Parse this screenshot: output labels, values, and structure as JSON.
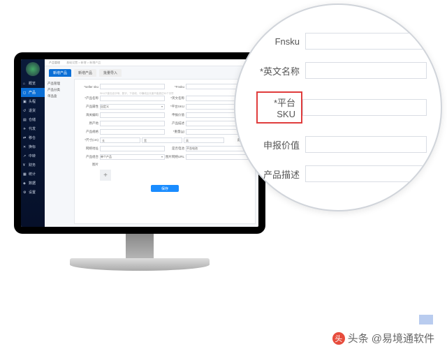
{
  "topbar": {
    "title": "产品管理",
    "crumb": "基础设置 > 新增 > 新增产品"
  },
  "sidebar": {
    "items": [
      {
        "label": "概览"
      },
      {
        "label": "产品"
      },
      {
        "label": "头程"
      },
      {
        "label": "退货"
      },
      {
        "label": "仓储"
      },
      {
        "label": "代发"
      },
      {
        "label": "移仓"
      },
      {
        "label": "换标"
      },
      {
        "label": "中转"
      },
      {
        "label": "财务"
      },
      {
        "label": "统计"
      },
      {
        "label": "数据"
      },
      {
        "label": "设置"
      }
    ]
  },
  "tree": {
    "items": [
      "产品管理",
      "产品分类",
      "单品盒"
    ]
  },
  "tabs": [
    {
      "label": "新增产品",
      "active": true
    },
    {
      "label": "新增产品",
      "active": false
    },
    {
      "label": "批量导入",
      "active": false
    }
  ],
  "form": {
    "seller_sku": "*seller sku",
    "fnsku": "*Fnsku",
    "hint": "SKU只能包含字母、数字、下划线、中横线且长度不能超过30个字符",
    "cn_name": "*产品名称",
    "en_name": "*英文名称",
    "attr": "产品属性",
    "attr_val": "自定义",
    "plat_sku": "*平台SKU",
    "hscode": "海关编码",
    "declare_val": "申报价值",
    "origin": "原产地",
    "desc": "产品描述",
    "spec": "产品规格",
    "weight": "*重量(g)",
    "size": "*尺寸(cm)",
    "size_l": "长",
    "size_w": "宽",
    "size_h": "高",
    "color": "颜色",
    "url": "网络地址",
    "is_battery": "是否电池",
    "is_battery_val": "不含电池",
    "combo": "产品组合",
    "combo_val": "单个产品",
    "img_url": "图片网络URL",
    "image": "图片",
    "save": "保存"
  },
  "magnifier": {
    "rows": [
      {
        "label": "Fnsku",
        "hl": false
      },
      {
        "label": "*英文名称",
        "hl": false
      },
      {
        "label": "*平台SKU",
        "hl": true
      },
      {
        "label": "申报价值",
        "hl": false
      },
      {
        "label": "产品描述",
        "hl": false
      }
    ]
  },
  "watermark": {
    "prefix": "头条",
    "author": "@易境通软件"
  }
}
